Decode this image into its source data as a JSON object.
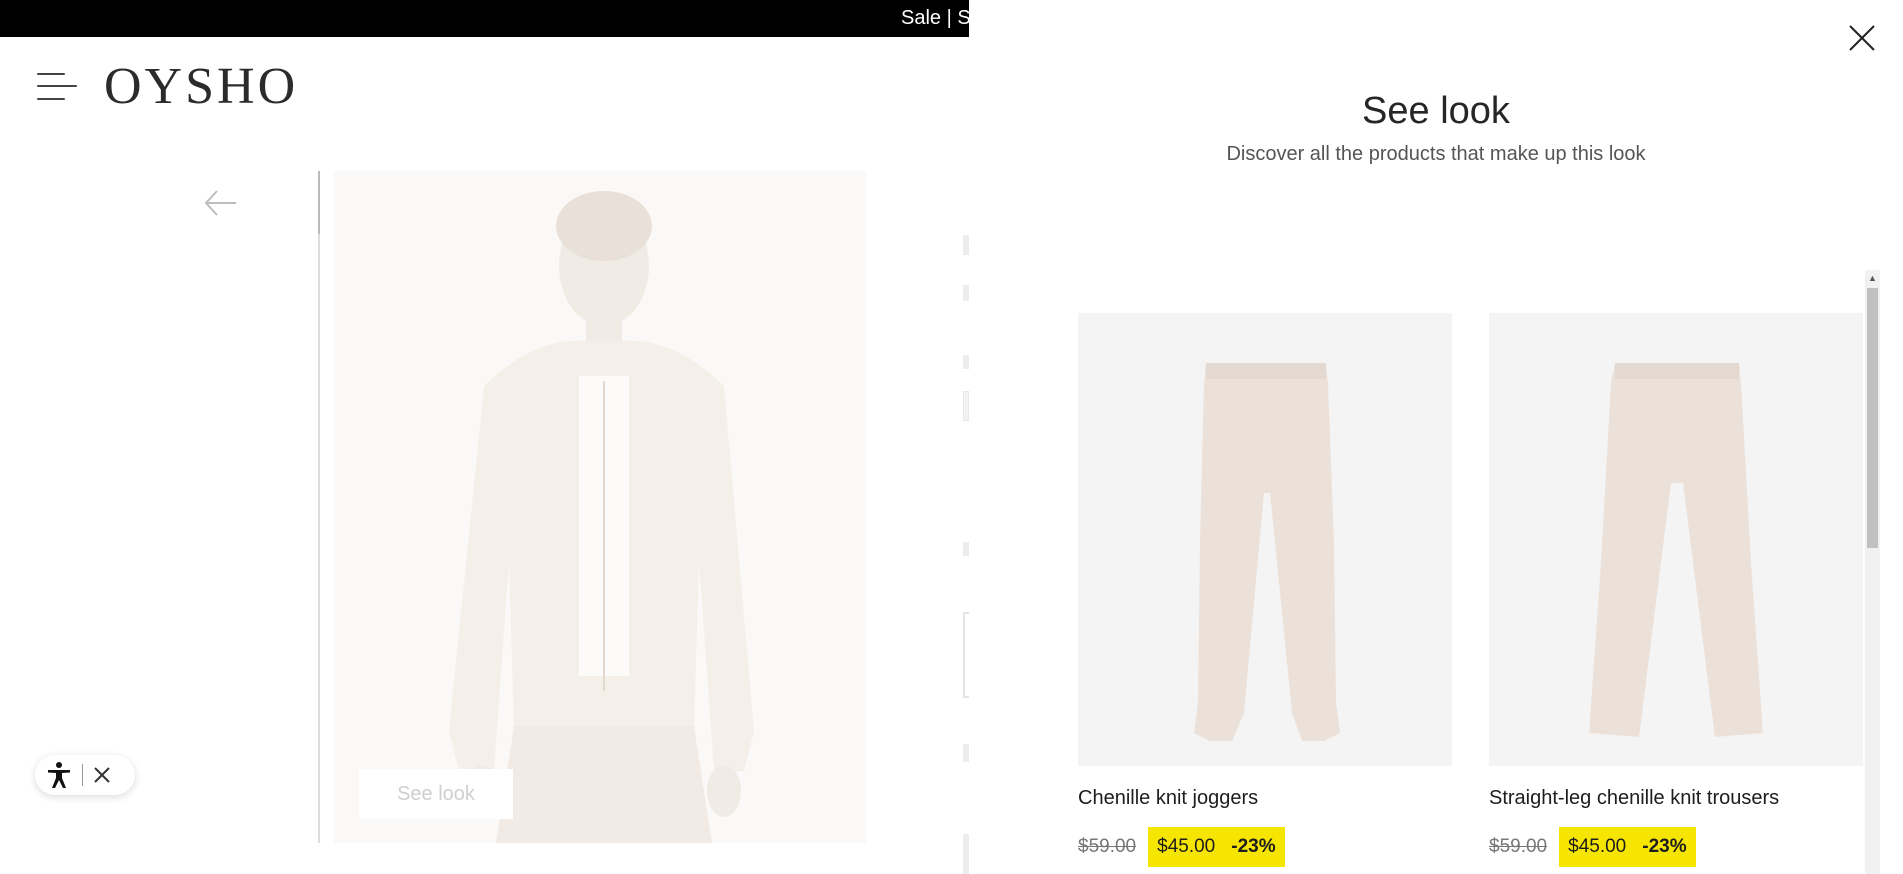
{
  "promo": {
    "text": "Sale | S"
  },
  "header": {
    "logo": "OYSHO"
  },
  "product": {
    "see_look_label": "See look"
  },
  "drawer": {
    "title": "See look",
    "subtitle": "Discover all the products that make up this look",
    "products": [
      {
        "name": "Chenille knit joggers",
        "old_price": "$59.00",
        "new_price": "$45.00",
        "discount": "-23%"
      },
      {
        "name": "Straight-leg chenille knit trousers",
        "old_price": "$59.00",
        "new_price": "$45.00",
        "discount": "-23%"
      }
    ]
  },
  "colors": {
    "sale_highlight": "#f6e500",
    "promo_bar": "#000000",
    "product_beige": "#e9ded5"
  },
  "icons": {
    "menu": "hamburger-icon",
    "back": "arrow-left-icon",
    "close": "close-icon",
    "accessibility": "accessibility-icon",
    "scroll_up": "scroll-up-icon"
  }
}
